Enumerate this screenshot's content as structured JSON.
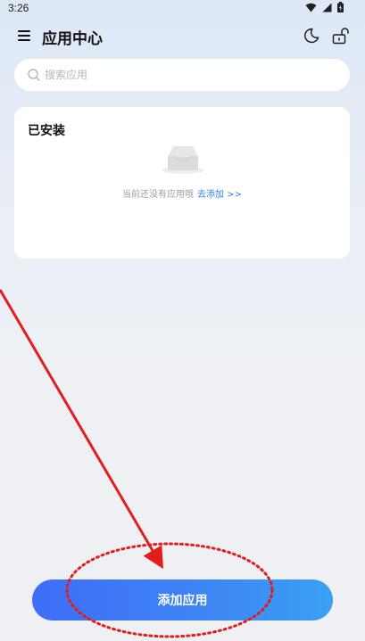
{
  "status_bar": {
    "time": "3:26",
    "icons": [
      "wifi-icon",
      "signal-icon",
      "battery-icon"
    ]
  },
  "app_bar": {
    "title": "应用中心",
    "left_icon": "menu-icon",
    "right_icons": [
      "moon-icon",
      "unlock-icon"
    ]
  },
  "search": {
    "placeholder": "搜索应用",
    "value": ""
  },
  "installed": {
    "title": "已安装",
    "empty_text": "当前还没有应用哦",
    "add_link": "去添加 >>"
  },
  "add_button": {
    "label": "添加应用"
  },
  "colors": {
    "accent": "#3d7ef6",
    "link": "#2f80ed",
    "annotation": "#e11d1d"
  }
}
